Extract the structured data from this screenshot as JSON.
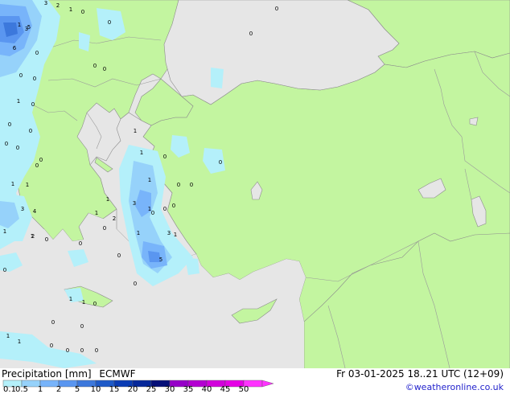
{
  "header": {
    "product": "Precipitation [mm]",
    "model": "ECMWF",
    "valid_time": "Fr 03-01-2025 18..21 UTC (12+09)",
    "credit": "©weatheronline.co.uk"
  },
  "colorbar": {
    "labels": [
      "0.1",
      "0.5",
      "1",
      "2",
      "5",
      "10",
      "15",
      "20",
      "25",
      "30",
      "35",
      "40",
      "45",
      "50"
    ],
    "colors": [
      "#b4f0fa",
      "#96d2fa",
      "#78b4fa",
      "#5a96f0",
      "#3c78dc",
      "#1e5ac8",
      "#0a3cb4",
      "#06289a",
      "#050f78",
      "#9600c8",
      "#b400d2",
      "#d200dc",
      "#e600e6",
      "#ff33ff"
    ]
  },
  "map_colors": {
    "sea": "#e6e6e6",
    "land": "#c3f5a0",
    "border": "#9a9a9a",
    "coast": "#8c8c8c"
  },
  "point_values": [
    "3",
    "2",
    "1",
    "0",
    "5",
    "6",
    "0",
    "0",
    "0",
    "0",
    "1",
    "0",
    "0",
    "0",
    "0",
    "0",
    "0",
    "1",
    "4",
    "3",
    "1",
    "0",
    "1",
    "1",
    "1",
    "1",
    "3",
    "5",
    "0",
    "1",
    "2",
    "1",
    "0",
    "0",
    "0",
    "0",
    "0",
    "0",
    "0",
    "3",
    "1",
    "1",
    "0",
    "1",
    "0",
    "0",
    "0",
    "0",
    "0",
    "0",
    "3",
    "1",
    "1",
    "2",
    "0",
    "0",
    "0",
    "0",
    "0",
    "0",
    "1",
    "1",
    "0",
    "0",
    "1",
    "1",
    "0"
  ]
}
